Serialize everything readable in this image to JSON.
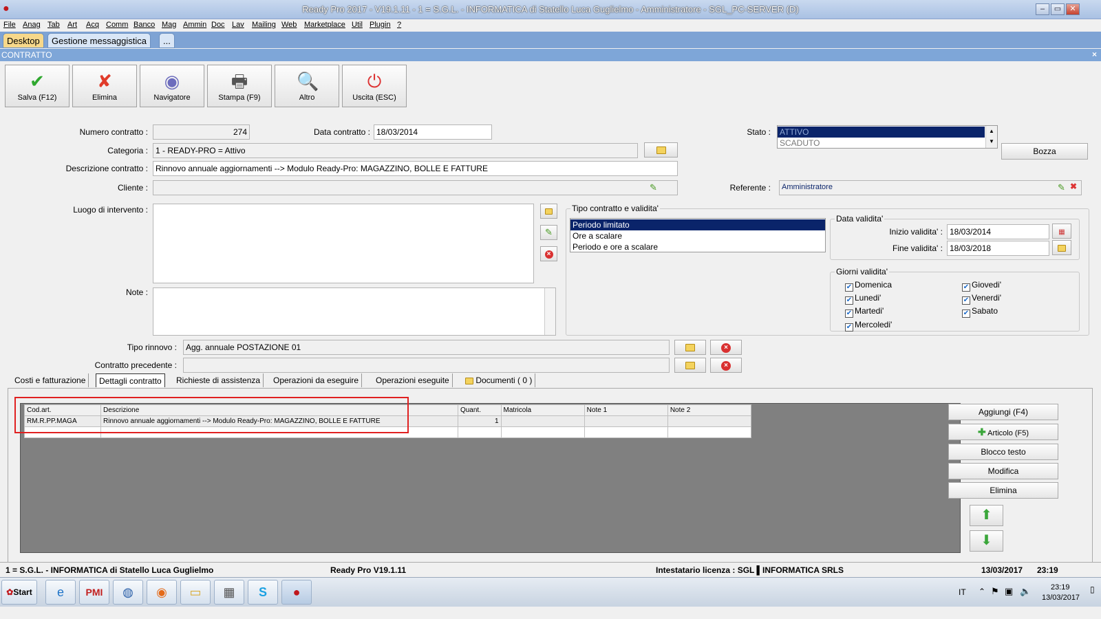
{
  "window": {
    "title": "Ready Pro 2017 - V19.1.11 - 1 = S.G.L. - INFORMATICA di Statello Luca Guglielmo - Amministratore - SGL_PC-SERVER (D)",
    "min": "–",
    "restore": "▭",
    "close": "✕"
  },
  "menu": [
    "File",
    "Anag",
    "Tab",
    "Art",
    "Acq",
    "Comm",
    "Banco",
    "Mag",
    "Ammin",
    "Doc",
    "Lav",
    "Mailing",
    "Web",
    "Marketplace",
    "Util",
    "Plugin",
    "?"
  ],
  "tabs": [
    "Desktop",
    "Gestione messaggistica",
    "..."
  ],
  "section": {
    "title": "CONTRATTO",
    "close": "×"
  },
  "toolbar": [
    {
      "label": "Salva (F12)",
      "icon": "✔",
      "color": "#2fa82f"
    },
    {
      "label": "Elimina",
      "icon": "✘",
      "color": "#e03b2a"
    },
    {
      "label": "Navigatore",
      "icon": "◉",
      "color": "#6c6cbd"
    },
    {
      "label": "Stampa (F9)",
      "icon": "🖶",
      "color": "#555"
    },
    {
      "label": "Altro",
      "icon": "🔍",
      "color": "#2b6cb0"
    },
    {
      "label": "Uscita (ESC)",
      "icon": "⏻",
      "color": "#d33"
    }
  ],
  "form": {
    "numero_label": "Numero contratto :",
    "numero": "274",
    "data_label": "Data contratto :",
    "data": "18/03/2014",
    "categoria_label": "Categoria :",
    "categoria": "1 - READY-PRO = Attivo",
    "descrizione_label": "Descrizione contratto :",
    "descrizione": "Rinnovo annuale aggiornamenti --> Modulo Ready-Pro: MAGAZZINO, BOLLE E FATTURE",
    "cliente_label": "Cliente :",
    "cliente": "",
    "luogo_label": "Luogo di intervento :",
    "luogo": "",
    "note_label": "Note :",
    "note": "",
    "stato_label": "Stato :",
    "stato_options": [
      "ATTIVO",
      "SCADUTO"
    ],
    "bozza": "Bozza",
    "referente_label": "Referente :",
    "referente": "Amministratore",
    "tipo_rinnovo_label": "Tipo rinnovo :",
    "tipo_rinnovo": "Agg. annuale POSTAZIONE 01",
    "precedente_label": "Contratto precedente :",
    "precedente": ""
  },
  "tipo_contratto": {
    "title": "Tipo contratto e validita'",
    "options": [
      "Periodo limitato",
      "Ore a scalare",
      "Periodo e ore a scalare"
    ]
  },
  "data_validita": {
    "title": "Data validita'",
    "inizio_label": "Inizio validita' :",
    "inizio": "18/03/2014",
    "fine_label": "Fine validita' :",
    "fine": "18/03/2018"
  },
  "giorni": {
    "title": "Giorni validita'",
    "days": [
      "Domenica",
      "Lunedi'",
      "Martedi'",
      "Mercoledi'",
      "Giovedi'",
      "Venerdi'",
      "Sabato"
    ]
  },
  "detail_tabs": [
    "Costi e fatturazione",
    "Dettagli contratto",
    "Richieste di assistenza",
    "Operazioni da eseguire",
    "Operazioni eseguite",
    "Documenti ( 0 )"
  ],
  "grid": {
    "headers": [
      "Cod.art.",
      "Descrizione",
      "Quant.",
      "Matricola",
      "Note 1",
      "Note 2"
    ],
    "rows": [
      [
        "RM.R.PP.MAGA",
        "Rinnovo annuale aggiornamenti --> Modulo Ready-Pro: MAGAZZINO, BOLLE E FATTURE",
        "1",
        "",
        "",
        ""
      ]
    ]
  },
  "side_buttons": [
    "Aggiungi (F4)",
    "Articolo (F5)",
    "Blocco testo",
    "Modifica",
    "Elimina"
  ],
  "status": {
    "ditta": "1 = S.G.L. - INFORMATICA di Statello Luca Guglielmo",
    "version": "Ready Pro V19.1.11",
    "licenza": "Intestatario licenza : SGL ▌INFORMATICA SRLS",
    "date": "13/03/2017",
    "time": "23:19"
  },
  "taskbar": {
    "start": "Start",
    "lang": "IT",
    "clock_time": "23:19",
    "clock_date": "13/03/2017"
  },
  "colors": {
    "accent": "#0a246a",
    "tab_active": "#f7d88a",
    "highlight": "#e02020"
  }
}
